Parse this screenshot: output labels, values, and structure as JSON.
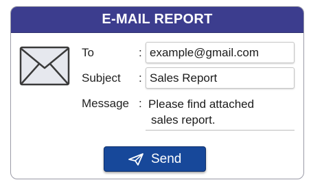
{
  "dialog": {
    "title": "E-MAIL REPORT",
    "header_color": "#3c3d8e"
  },
  "form": {
    "to_label": "To",
    "to_colon": ":",
    "to_value": "example@gmail.com",
    "subject_label": "Subject",
    "subject_colon": ":",
    "subject_value": "Sales Report",
    "message_label": "Message",
    "message_colon": ":",
    "message_line1": "Please find attached",
    "message_line2": "sales report."
  },
  "actions": {
    "send_label": "Send",
    "send_color": "#17489a"
  },
  "icons": {
    "envelope": "envelope-icon",
    "send": "paper-plane-icon"
  }
}
